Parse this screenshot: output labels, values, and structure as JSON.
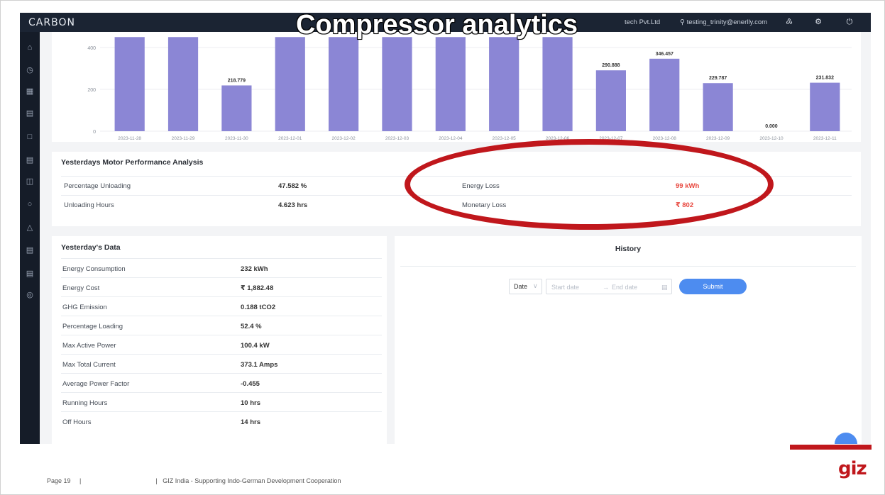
{
  "slide": {
    "title": "Compressor analytics",
    "footer_page": "Page 19",
    "footer_sep1": "|",
    "footer_sep2": "|",
    "footer_org": "GIZ India - Supporting Indo-German Development Cooperation",
    "logo_text": "giz",
    "accent_color": "#c0171c"
  },
  "app": {
    "brand": "CARBON",
    "company": "tech Pvt.Ltd",
    "user": "testing_trinity@enerlly.com",
    "top_icons": [
      "user-icon",
      "bell-icon",
      "gear-icon",
      "power-icon"
    ],
    "sidebar_icons": [
      "home-icon",
      "dashboard-icon",
      "grid-icon",
      "report-icon",
      "document-icon",
      "list-icon",
      "database-icon",
      "bulb-icon",
      "hierarchy-icon",
      "factory-icon",
      "file-icon",
      "help-icon"
    ]
  },
  "chart_data": {
    "type": "bar",
    "categories": [
      "2023-11-28",
      "2023-11-29",
      "2023-11-30",
      "2023-12-01",
      "2023-12-02",
      "2023-12-03",
      "2023-12-04",
      "2023-12-05",
      "2023-12-06",
      "2023-12-07",
      "2023-12-08",
      "2023-12-09",
      "2023-12-10",
      "2023-12-11"
    ],
    "values": [
      450,
      450,
      218.779,
      450,
      450,
      450,
      450,
      450,
      450,
      290.888,
      346.457,
      229.787,
      0.0,
      231.832
    ],
    "labels": [
      "",
      "",
      "218.779",
      "",
      "",
      "",
      "",
      "",
      "",
      "290.888",
      "346.457",
      "229.787",
      "0.000",
      "231.832"
    ],
    "yticks": [
      0,
      200,
      400
    ],
    "ylim": [
      0,
      450
    ],
    "bar_color": "#8b86d5",
    "grid": true
  },
  "performance": {
    "title": "Yesterdays Motor Performance Analysis",
    "rows": [
      {
        "label": "Percentage Unloading",
        "value": "47.582 %",
        "label2": "Energy Loss",
        "value2": "99 kWh"
      },
      {
        "label": "Unloading Hours",
        "value": "4.623 hrs",
        "label2": "Monetary Loss",
        "value2": "₹ 802"
      }
    ]
  },
  "yesterday": {
    "title": "Yesterday's Data",
    "rows": [
      {
        "label": "Energy Consumption",
        "value": "232 kWh"
      },
      {
        "label": "Energy Cost",
        "value": "₹ 1,882.48"
      },
      {
        "label": "GHG Emission",
        "value": "0.188 tCO2"
      },
      {
        "label": "Percentage Loading",
        "value": "52.4 %"
      },
      {
        "label": "Max Active Power",
        "value": "100.4 kW"
      },
      {
        "label": "Max Total Current",
        "value": "373.1 Amps"
      },
      {
        "label": "Average Power Factor",
        "value": "-0.455"
      },
      {
        "label": "Running Hours",
        "value": "10 hrs"
      },
      {
        "label": "Off Hours",
        "value": "14 hrs"
      }
    ]
  },
  "history": {
    "title": "History",
    "date_select": "Date",
    "start_placeholder": "Start date",
    "arrow": "→",
    "end_placeholder": "End date",
    "submit_label": "Submit"
  }
}
